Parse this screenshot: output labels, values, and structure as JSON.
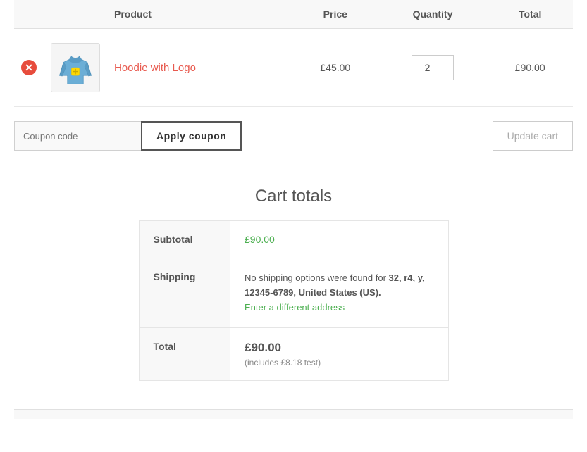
{
  "header": {
    "col_remove": "",
    "col_thumb": "",
    "col_product": "Product",
    "col_price": "Price",
    "col_quantity": "Quantity",
    "col_total": "Total"
  },
  "cart": {
    "items": [
      {
        "id": "hoodie-logo",
        "name": "Hoodie with Logo",
        "price": "£45.00",
        "quantity": 2,
        "total": "£90.00"
      }
    ]
  },
  "coupon": {
    "placeholder": "Coupon code",
    "button_label": "Apply coupon"
  },
  "update_cart": {
    "label": "Update cart"
  },
  "cart_totals": {
    "title": "Cart totals",
    "subtotal_label": "Subtotal",
    "subtotal_value": "£90.00",
    "shipping_label": "Shipping",
    "shipping_message": "No shipping options were found for ",
    "shipping_address": "32, r4, y, 12345-6789, United States (US).",
    "shipping_link_text": "Enter a different address",
    "total_label": "Total",
    "total_value": "£90.00",
    "total_includes": "(includes £8.18 test)"
  },
  "icons": {
    "remove": "✕",
    "cursor": "default"
  }
}
